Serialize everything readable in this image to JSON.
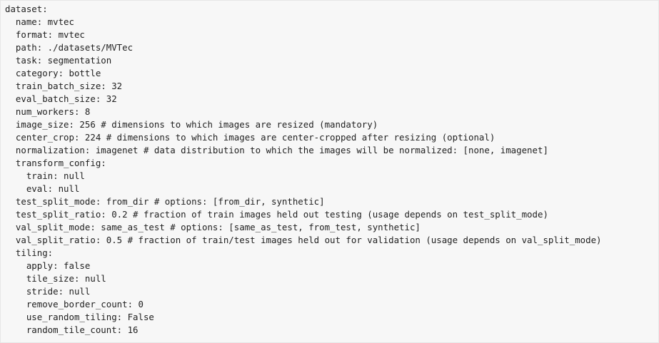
{
  "code": {
    "lines": [
      "dataset:",
      "  name: mvtec",
      "  format: mvtec",
      "  path: ./datasets/MVTec",
      "  task: segmentation",
      "  category: bottle",
      "  train_batch_size: 32",
      "  eval_batch_size: 32",
      "  num_workers: 8",
      "  image_size: 256 # dimensions to which images are resized (mandatory)",
      "  center_crop: 224 # dimensions to which images are center-cropped after resizing (optional)",
      "  normalization: imagenet # data distribution to which the images will be normalized: [none, imagenet]",
      "  transform_config:",
      "    train: null",
      "    eval: null",
      "  test_split_mode: from_dir # options: [from_dir, synthetic]",
      "  test_split_ratio: 0.2 # fraction of train images held out testing (usage depends on test_split_mode)",
      "  val_split_mode: same_as_test # options: [same_as_test, from_test, synthetic]",
      "  val_split_ratio: 0.5 # fraction of train/test images held out for validation (usage depends on val_split_mode)",
      "  tiling:",
      "    apply: false",
      "    tile_size: null",
      "    stride: null",
      "    remove_border_count: 0",
      "    use_random_tiling: False",
      "    random_tile_count: 16"
    ]
  }
}
